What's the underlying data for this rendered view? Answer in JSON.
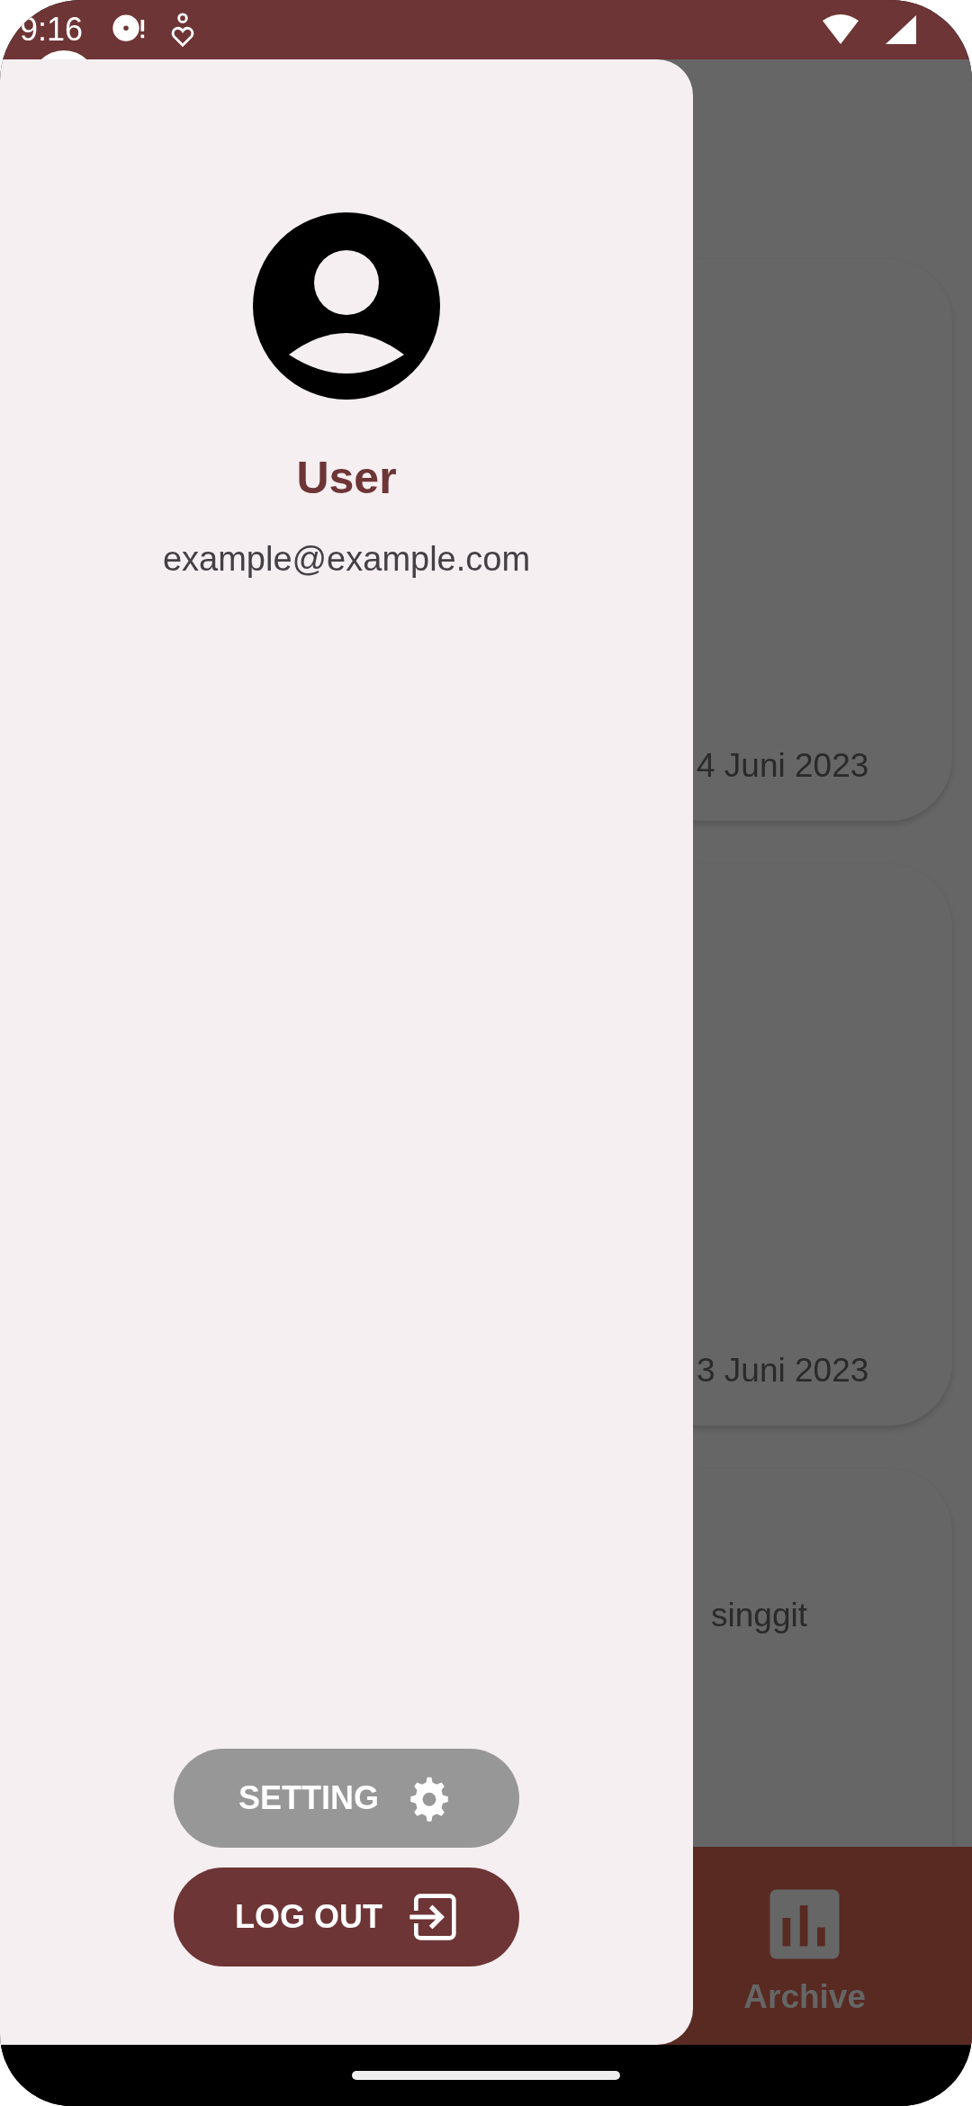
{
  "status_bar": {
    "time": "9:16"
  },
  "drawer": {
    "user_name": "User",
    "email": "example@example.com",
    "buttons": [
      {
        "label": "SETTING",
        "kind": "setting"
      },
      {
        "label": "LOG OUT",
        "kind": "logout"
      }
    ]
  },
  "cards": [
    {
      "kind": "date",
      "text": "4 Juni 2023"
    },
    {
      "kind": "date",
      "text": "3 Juni 2023"
    },
    {
      "kind": "title",
      "text": "singgit"
    }
  ],
  "bottom_nav": {
    "items": [
      {
        "label": "Archive"
      }
    ]
  }
}
